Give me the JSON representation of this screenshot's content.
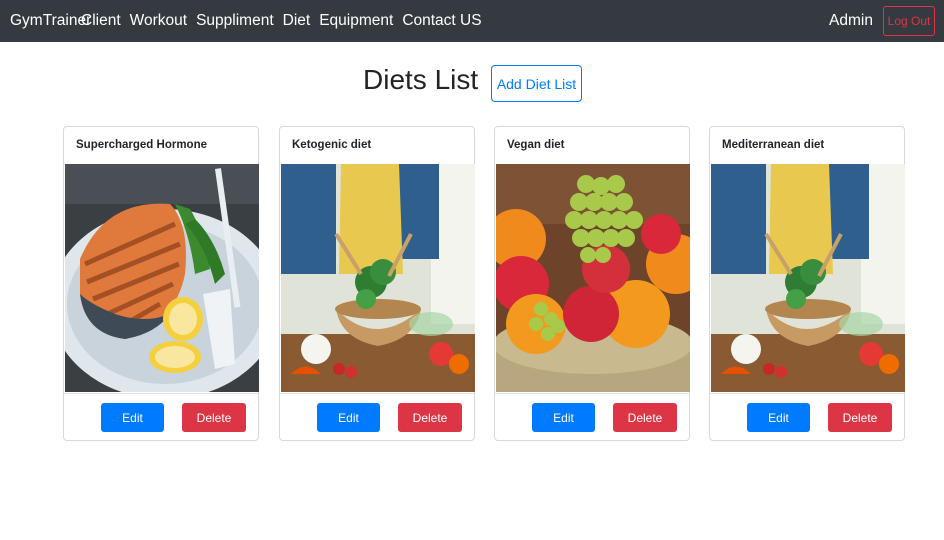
{
  "navbar": {
    "brand": "GymTrainer",
    "links": [
      "Client",
      "Workout",
      "Suppliment",
      "Diet",
      "Equipment",
      "Contact US"
    ],
    "user": "Admin",
    "logout_label": "Log Out"
  },
  "page": {
    "title": "Diets List",
    "add_label": "Add Diet List"
  },
  "diets": [
    {
      "name": "Supercharged Hormone",
      "image": "grilled-salmon-plate",
      "edit_label": "Edit",
      "delete_label": "Delete"
    },
    {
      "name": "Ketogenic diet",
      "image": "salad-preparation",
      "edit_label": "Edit",
      "delete_label": "Delete"
    },
    {
      "name": "Vegan diet",
      "image": "fruit-bowl",
      "edit_label": "Edit",
      "delete_label": "Delete"
    },
    {
      "name": "Mediterranean diet",
      "image": "salad-preparation",
      "edit_label": "Edit",
      "delete_label": "Delete"
    }
  ],
  "colors": {
    "navbar_bg": "#343a40",
    "primary": "#007bff",
    "danger": "#dc3545"
  }
}
